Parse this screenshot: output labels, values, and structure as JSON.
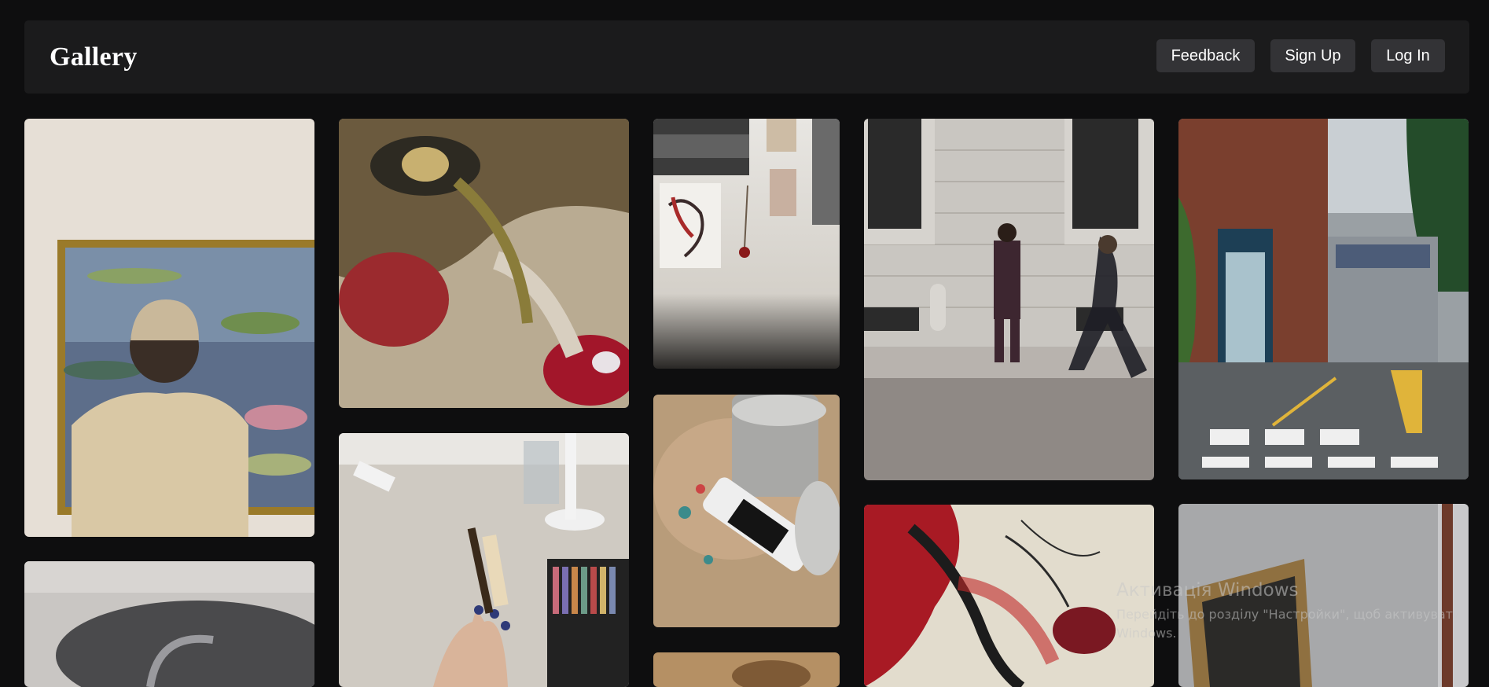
{
  "header": {
    "brand": "Gallery",
    "buttons": {
      "feedback": "Feedback",
      "signup": "Sign Up",
      "login": "Log In"
    }
  },
  "gallery": {
    "images": [
      "museum-visitor-water-lilies",
      "oil-painting-face-closeup",
      "wall-sketches-and-rose",
      "street-pedestrians-stone-wall",
      "rainy-street-korean-crosswalk",
      "art-studio-desk-pastels",
      "paint-tubes-and-tin",
      "abstract-red-painting",
      "ornate-picture-frame",
      "studio-chair",
      "partial-artwork"
    ]
  },
  "watermark": {
    "title": "Активація Windows",
    "line1": "Перейдіть до розділу \"Настройки\", щоб активувати",
    "line2": "Windows."
  }
}
